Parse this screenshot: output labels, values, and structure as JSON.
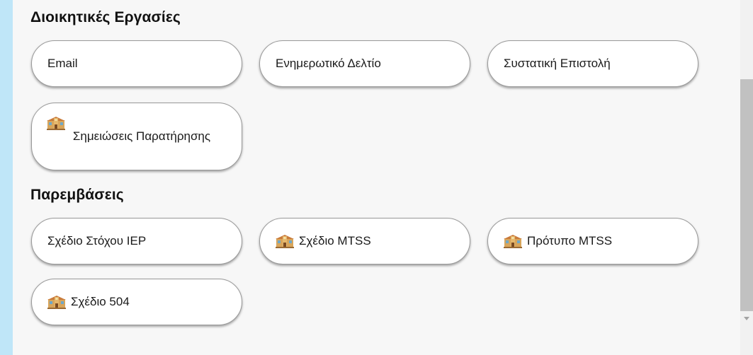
{
  "sections": [
    {
      "title": "Διοικητικές Εργασίες",
      "items": [
        {
          "label": "Email",
          "icon": ""
        },
        {
          "label": "Ενημερωτικό Δελτίο",
          "icon": ""
        },
        {
          "label": "Συστατική Επιστολή",
          "icon": ""
        },
        {
          "label": "Σημειώσεις Παρατήρησης",
          "icon": "school-icon"
        }
      ]
    },
    {
      "title": "Παρεμβάσεις",
      "items": [
        {
          "label": "Σχέδιο Στόχου IEP",
          "icon": ""
        },
        {
          "label": "Σχέδιο MTSS",
          "icon": "school-icon"
        },
        {
          "label": "Πρότυπο MTSS",
          "icon": "school-icon"
        },
        {
          "label": "Σχέδιο 504",
          "icon": "school-icon"
        }
      ]
    }
  ],
  "colors": {
    "background": "#c8ecfb",
    "panel": "#f7f7f7",
    "pill_border": "#9a9a9a",
    "scroll_thumb": "#c1c1c1"
  }
}
